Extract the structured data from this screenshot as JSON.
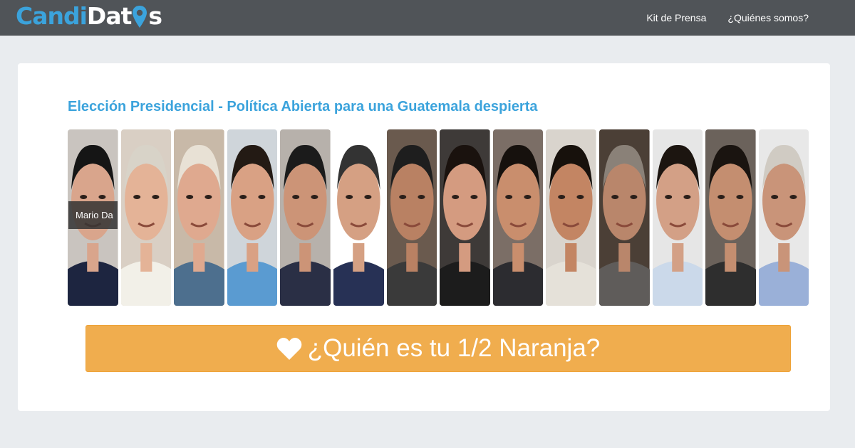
{
  "brand": {
    "part1": "Candi",
    "part2": "Dat",
    "part3": "s"
  },
  "nav": {
    "links": [
      {
        "label": "Kit de Prensa"
      },
      {
        "label": "¿Quiénes somos?"
      }
    ]
  },
  "main": {
    "heading": "Elección Presidencial - Política Abierta para una Guatemala despierta",
    "tooltip": "Mario Da",
    "cta_label": "¿Quién es tu 1/2 Naranja?"
  },
  "colors": {
    "accent": "#3ba3dc",
    "navbar": "#505458",
    "cta": "#f0ad4e",
    "page_bg": "#e9ecef"
  },
  "candidates": [
    {
      "skin": "#d9a58c",
      "hair": "#151515",
      "clothes": "#1d2540",
      "bg": "#c9c4bf"
    },
    {
      "skin": "#e4b397",
      "hair": "#d8d3c8",
      "clothes": "#f2f0e8",
      "bg": "#d9cfc4"
    },
    {
      "skin": "#dfa98f",
      "hair": "#e8e1d5",
      "clothes": "#4d6f8e",
      "bg": "#c8b9a8"
    },
    {
      "skin": "#d9a184",
      "hair": "#231a14",
      "clothes": "#5a9bd1",
      "bg": "#cfd5da"
    },
    {
      "skin": "#cc9477",
      "hair": "#1b1b1b",
      "clothes": "#2a2f45",
      "bg": "#b7b1ab"
    },
    {
      "skin": "#d5a083",
      "hair": "#333333",
      "clothes": "#273155",
      "bg": "#ffffff"
    },
    {
      "skin": "#b98163",
      "hair": "#1e1e1e",
      "clothes": "#3a3a3a",
      "bg": "#6a5a4e"
    },
    {
      "skin": "#d49b80",
      "hair": "#1a120e",
      "clothes": "#1c1c1c",
      "bg": "#3e3a38"
    },
    {
      "skin": "#c98e6d",
      "hair": "#16110d",
      "clothes": "#2c2c30",
      "bg": "#7b6e66"
    },
    {
      "skin": "#c38563",
      "hair": "#17110c",
      "clothes": "#e5e1d9",
      "bg": "#d9d4cd"
    },
    {
      "skin": "#b9866b",
      "hair": "#8a8178",
      "clothes": "#5f5c5a",
      "bg": "#4b3f36"
    },
    {
      "skin": "#d3a086",
      "hair": "#1c1510",
      "clothes": "#cbd9ea",
      "bg": "#e6e6e6"
    },
    {
      "skin": "#c48e70",
      "hair": "#1a1410",
      "clothes": "#2e2e2e",
      "bg": "#6b625b"
    },
    {
      "skin": "#c99479",
      "hair": "#d0cbc3",
      "clothes": "#9ab0d8",
      "bg": "#e8e8e8"
    }
  ]
}
